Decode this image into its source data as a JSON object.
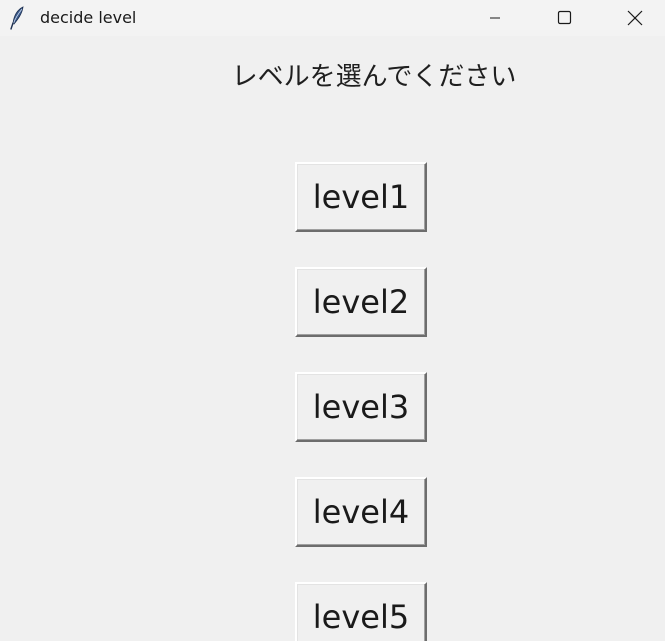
{
  "window": {
    "title": "decide level",
    "icon": "feather-icon"
  },
  "titlebar_controls": {
    "minimize": "minimize-icon",
    "maximize": "maximize-icon",
    "close": "close-icon"
  },
  "main": {
    "prompt": "レベルを選んでください",
    "buttons": [
      {
        "label": "level1"
      },
      {
        "label": "level2"
      },
      {
        "label": "level3"
      },
      {
        "label": "level4"
      },
      {
        "label": "level5"
      }
    ]
  }
}
